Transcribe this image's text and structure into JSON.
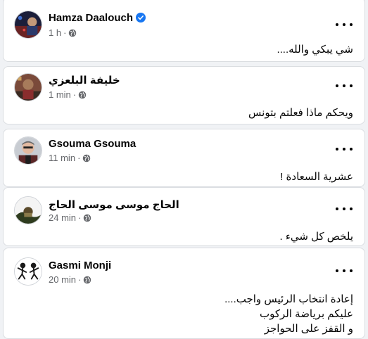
{
  "comments": [
    {
      "author": "Hamza Daalouch",
      "verified": true,
      "time": "1 h",
      "sep": "·",
      "text": "شي يبكي والله...."
    },
    {
      "author": "خليفة البلعزي",
      "verified": false,
      "time": "1 min",
      "sep": "·",
      "text": "ويحكم ماذا فعلتم بتونس"
    },
    {
      "author": "Gsouma Gsouma",
      "verified": false,
      "time": "11 min",
      "sep": "·",
      "text": "عشرية السعادة !"
    },
    {
      "author": "الحاج موسى موسى الحاج",
      "verified": false,
      "time": "24 min",
      "sep": "·",
      "text": "يلخص كل شيء ."
    },
    {
      "author": "Gasmi Monji",
      "verified": false,
      "time": "20 min",
      "sep": "·",
      "text": "إعادة انتخاب الرئيس واجب....\nعليكم برياضة الركوب\nو القفز على الحواجز"
    }
  ],
  "colors": {
    "background": "#f0f2f5",
    "card": "#ffffff",
    "verified": "#1877f2",
    "meta_text": "#65676b"
  }
}
